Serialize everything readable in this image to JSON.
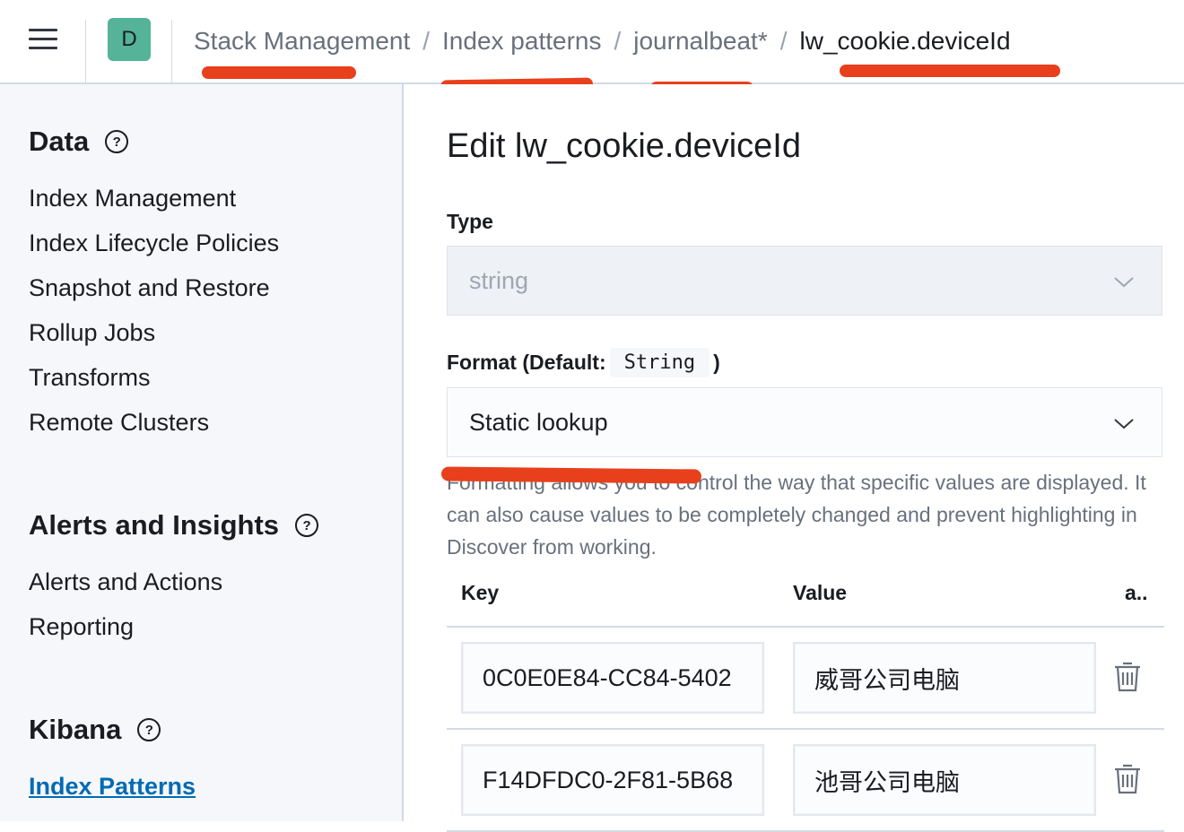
{
  "header": {
    "avatar_letter": "D",
    "breadcrumbs": [
      "Stack Management",
      "Index patterns",
      "journalbeat*",
      "lw_cookie.deviceId"
    ],
    "separator": "/"
  },
  "sidebar": {
    "sections": [
      {
        "title": "Data",
        "items": [
          "Index Management",
          "Index Lifecycle Policies",
          "Snapshot and Restore",
          "Rollup Jobs",
          "Transforms",
          "Remote Clusters"
        ]
      },
      {
        "title": "Alerts and Insights",
        "items": [
          "Alerts and Actions",
          "Reporting"
        ]
      },
      {
        "title": "Kibana",
        "items": [
          "Index Patterns"
        ]
      }
    ],
    "active_item": "Index Patterns"
  },
  "main": {
    "title": "Edit lw_cookie.deviceId",
    "type_label": "Type",
    "type_value": "string",
    "format_label_prefix": "Format (Default:",
    "format_default": "String",
    "format_label_suffix": ")",
    "format_value": "Static lookup",
    "help_text": "Formatting allows you to control the way that specific values are displayed. It can also cause values to be completely changed and prevent highlighting in Discover from working.",
    "table": {
      "headers": [
        "Key",
        "Value",
        "a.."
      ],
      "rows": [
        {
          "key": "0C0E0E84-CC84-5402",
          "value": "威哥公司电脑"
        },
        {
          "key": "F14DFDC0-2F81-5B68",
          "value": "池哥公司电脑"
        }
      ]
    }
  },
  "icons": {
    "menu": "hamburger-icon",
    "help": "question-circle-icon",
    "select": "chevron-down-icon",
    "delete": "trash-icon"
  },
  "colors": {
    "accent": "#006bb4",
    "avatar_bg": "#54b399",
    "annotation_red": "#e8401c",
    "sidebar_bg": "#f5f7fa"
  }
}
